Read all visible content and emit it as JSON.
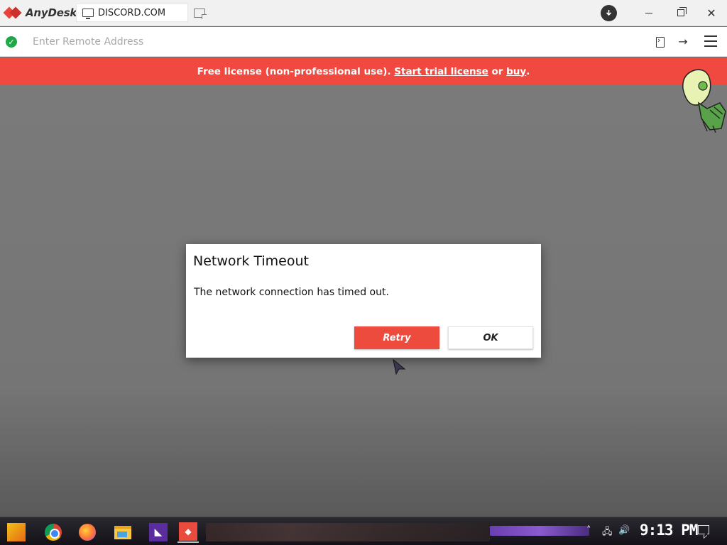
{
  "app": {
    "name": "AnyDesk",
    "tab_label": "DISCORD.COM",
    "status_icon": "download-status-icon"
  },
  "address_bar": {
    "placeholder": "Enter Remote Address",
    "value": ""
  },
  "banner": {
    "text_prefix": "Free license (non-professional use). ",
    "trial_link": "Start trial license",
    "or_text": " or ",
    "buy_link": "buy",
    "suffix": ".",
    "color": "#f04a40"
  },
  "dialog": {
    "title": "Network Timeout",
    "message": "The network connection has timed out.",
    "retry_label": "Retry",
    "ok_label": "OK"
  },
  "taskbar": {
    "clock": "9:13 PM",
    "apps": [
      "start-icon",
      "chrome-icon",
      "firefox-icon",
      "file-explorer-icon",
      "app-icon",
      "anydesk-icon"
    ]
  }
}
